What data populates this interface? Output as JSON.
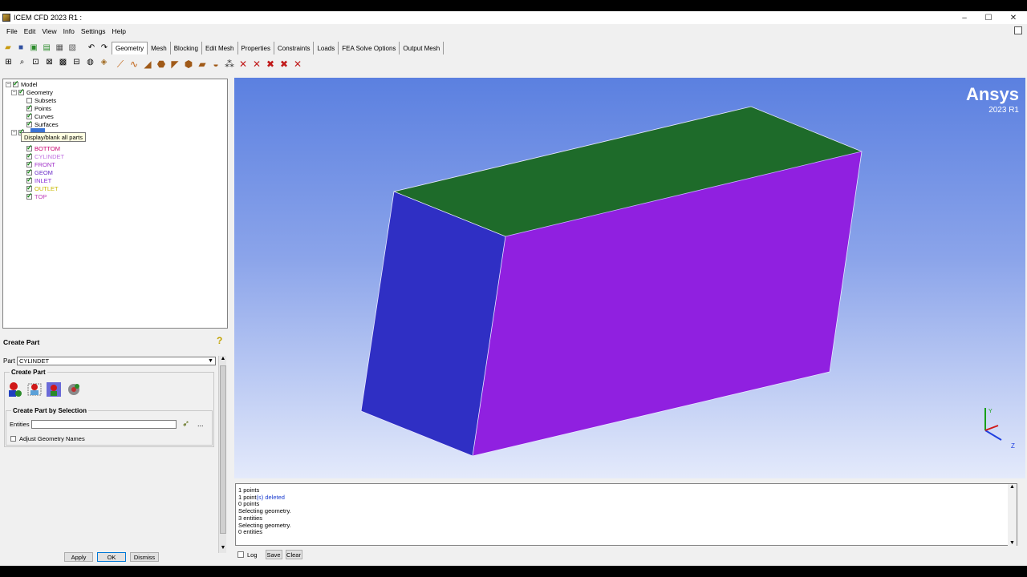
{
  "window": {
    "title": "ICEM CFD 2023 R1 :",
    "min": "–",
    "max": "☐",
    "close": "✕"
  },
  "menu": [
    "File",
    "Edit",
    "View",
    "Info",
    "Settings",
    "Help"
  ],
  "tabs": [
    "Geometry",
    "Mesh",
    "Blocking",
    "Edit Mesh",
    "Properties",
    "Constraints",
    "Loads",
    "FEA Solve Options",
    "Output Mesh"
  ],
  "active_tab": "Geometry",
  "tree": {
    "model": "Model",
    "geometry": "Geometry",
    "geometry_items": [
      {
        "label": "Subsets",
        "checked": false
      },
      {
        "label": "Points",
        "checked": true
      },
      {
        "label": "Curves",
        "checked": true
      },
      {
        "label": "Surfaces",
        "checked": true
      }
    ],
    "parts_label": "Parts",
    "tooltip": "Display/blank all parts",
    "parts": [
      {
        "label": "BOTTOM",
        "color": "#c8006e"
      },
      {
        "label": "CYLINDET",
        "color": "#c070e0"
      },
      {
        "label": "FRONT",
        "color": "#a030c8"
      },
      {
        "label": "GEOM",
        "color": "#6a2cc8"
      },
      {
        "label": "INLET",
        "color": "#8a2cd8"
      },
      {
        "label": "OUTLET",
        "color": "#c8b800"
      },
      {
        "label": "TOP",
        "color": "#c040b8"
      }
    ]
  },
  "create_part": {
    "title": "Create Part",
    "part_label": "Part",
    "part_value": "CYLINDET",
    "group_create": "Create Part",
    "group_selection": "Create Part by Selection",
    "entities_label": "Entities",
    "entities_value": "",
    "entities_more": "...",
    "adjust_label": "Adjust Geometry Names",
    "apply": "Apply",
    "ok": "OK",
    "dismiss": "Dismiss"
  },
  "viewport": {
    "brand": "Ansys",
    "version": "2023 R1",
    "colors": {
      "top_face": "#1e6b2a",
      "left_face": "#2f2fc4",
      "right_face": "#9020e0"
    },
    "axes": {
      "y": "Y",
      "z": "Z"
    }
  },
  "messages": {
    "lines": [
      {
        "pre": "1 points",
        "hl": "",
        "post": ""
      },
      {
        "pre": "1 point",
        "hl": "(s) deleted",
        "post": ""
      },
      {
        "pre": "0 points",
        "hl": "",
        "post": ""
      },
      {
        "pre": "Selecting geometry.",
        "hl": "",
        "post": ""
      },
      {
        "pre": "3 entities",
        "hl": "",
        "post": ""
      },
      {
        "pre": "Selecting geometry.",
        "hl": "",
        "post": ""
      },
      {
        "pre": "0 entities",
        "hl": "",
        "post": ""
      }
    ],
    "log_label": "Log",
    "save_label": "Save",
    "clear_label": "Clear"
  }
}
